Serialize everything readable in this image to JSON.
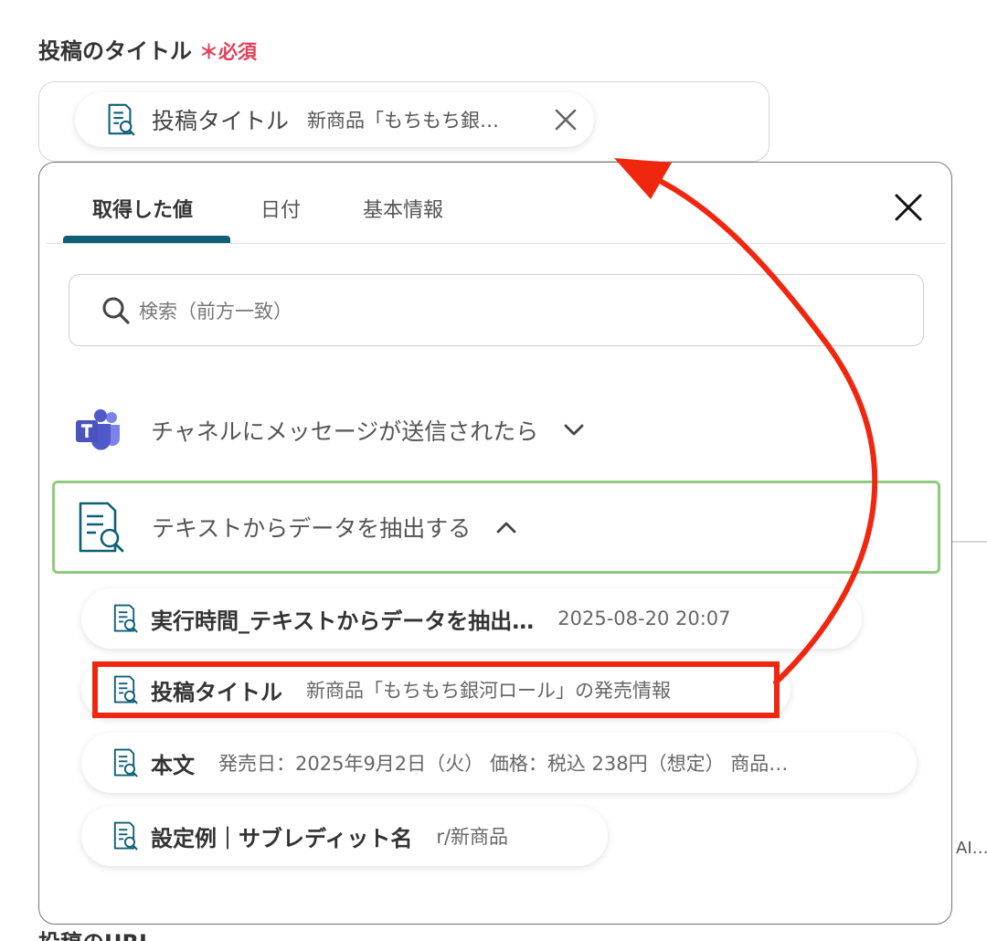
{
  "field": {
    "label": "投稿のタイトル",
    "required_mark": "＊必須",
    "chip_label": "投稿タイトル",
    "chip_value": "新商品「もちもち銀…"
  },
  "background": {
    "next_field_label": "投稿のURL",
    "side_text": "AI…"
  },
  "popup": {
    "tabs": [
      "取得した値",
      "日付",
      "基本情報"
    ],
    "active_tab": "取得した値",
    "search_placeholder": "検索（前方一致）",
    "groups": [
      {
        "label": "チャネルにメッセージが送信されたら",
        "icon": "microsoft-teams-icon",
        "expanded": false
      },
      {
        "label": "テキストからデータを抽出する",
        "icon": "document-search-icon",
        "expanded": true
      }
    ],
    "items": [
      {
        "label": "実行時間_テキストからデータを抽出…",
        "value": "2025-08-20 20:07"
      },
      {
        "label": "投稿タイトル",
        "value": "新商品「もちもち銀河ロール」の発売情報",
        "highlighted": true
      },
      {
        "label": "本文",
        "value": "発売日：2025年9月2日（火） 価格：税込 238円（想定） 商品…"
      },
      {
        "label": "設定例｜サブレディット名",
        "value": "r/新商品"
      }
    ]
  },
  "colors": {
    "brand_teal": "#0e5f77",
    "required_red": "#e0405a",
    "highlight_red": "#f0260f",
    "group_border_green": "#8fcb7f"
  }
}
